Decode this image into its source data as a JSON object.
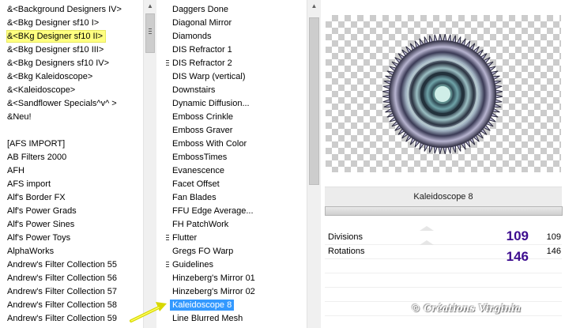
{
  "categories": [
    "&<Background Designers IV>",
    "&<Bkg Designer sf10 I>",
    "&<BKg Designer sf10 II>",
    "&<Bkg Designer sf10 III>",
    "&<Bkg Designers sf10 IV>",
    "&<Bkg Kaleidoscope>",
    "&<Kaleidoscope>",
    "&<Sandflower Specials^v^ >",
    "&Neu!",
    "",
    "[AFS IMPORT]",
    "AB Filters 2000",
    "AFH",
    "AFS import",
    "Alf's Border FX",
    "Alf's Power Grads",
    "Alf's Power Sines",
    "Alf's Power Toys",
    "AlphaWorks",
    "Andrew's Filter Collection 55",
    "Andrew's Filter Collection 56",
    "Andrew's Filter Collection 57",
    "Andrew's Filter Collection 58",
    "Andrew's Filter Collection 59"
  ],
  "filters": [
    "Daggers Done",
    "Diagonal Mirror",
    "Diamonds",
    "DIS Refractor 1",
    "DIS Refractor 2",
    "DIS Warp (vertical)",
    "Downstairs",
    "Dynamic Diffusion...",
    "Emboss Crinkle",
    "Emboss Graver",
    "Emboss With Color",
    "EmbossTimes",
    "Evanescence",
    "Facet Offset",
    "Fan Blades",
    "FFU Edge Average...",
    "FH PatchWork",
    "Flutter",
    "Gregs FO Warp",
    "Guidelines",
    "Hinzeberg's Mirror 01",
    "Hinzeberg's Mirror 02",
    "Kaleidoscope 8",
    "Line Blurred Mesh"
  ],
  "selected_filter_name": "Kaleidoscope 8",
  "params": [
    {
      "label": "Divisions",
      "value": "109",
      "value_small": "109"
    },
    {
      "label": "Rotations",
      "value": "146",
      "value_small": "146"
    }
  ],
  "credit": "© Créations Virginia",
  "colors": {
    "selection": "#3399ff",
    "highlight": "#ffff80",
    "param_value": "#3d0d8f"
  }
}
